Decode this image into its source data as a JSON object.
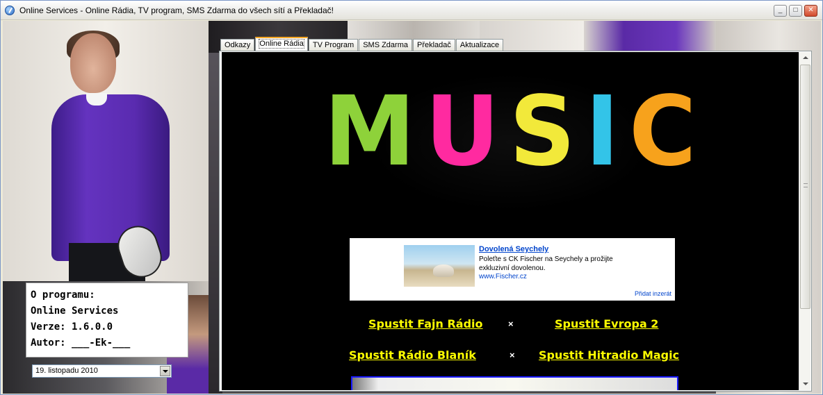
{
  "window": {
    "title": "Online Services - Online Rádia, TV program, SMS Zdarma do všech sítí a Překladač!",
    "controls": {
      "minimize": "_",
      "maximize": "□",
      "close": "✕"
    },
    "app_icon": "globe-icon"
  },
  "tabs": [
    {
      "label": "Odkazy",
      "active": false
    },
    {
      "label": "Online Rádia",
      "active": true
    },
    {
      "label": "TV Program",
      "active": false
    },
    {
      "label": "SMS Zdarma",
      "active": false
    },
    {
      "label": "Překladač",
      "active": false
    },
    {
      "label": "Aktualizace",
      "active": false
    }
  ],
  "about": {
    "line1": "O programu:",
    "line2": "Online Services",
    "line3": "Verze: 1.6.0.0",
    "line4": "Autor: ___-Ek-___"
  },
  "date_picker": {
    "value": "19. listopadu 2010"
  },
  "content": {
    "logo_letters": [
      "M",
      "U",
      "S",
      "I",
      "C"
    ],
    "logo_colors": [
      "#8ed23a",
      "#ff2aa0",
      "#f2e93a",
      "#33c4e8",
      "#f7a21c"
    ],
    "ad": {
      "title": "Dovolená Seychely",
      "text": "Poleťte s CK Fischer na Seychely a prožijte exkluzivní dovolenou.",
      "url": "www.Fischer.cz",
      "add_link": "Přidat inzerát"
    },
    "radios": [
      {
        "label": "Spustit Fajn Rádio"
      },
      {
        "label": "Spustit Evropa 2"
      },
      {
        "label": "Spustit Rádio Blaník"
      },
      {
        "label": "Spustit Hitradio Magic"
      }
    ],
    "separator": "×"
  },
  "colors": {
    "link_yellow": "#ffff00",
    "ad_link": "#0044cc",
    "active_tab_accent": "#f5a623"
  }
}
